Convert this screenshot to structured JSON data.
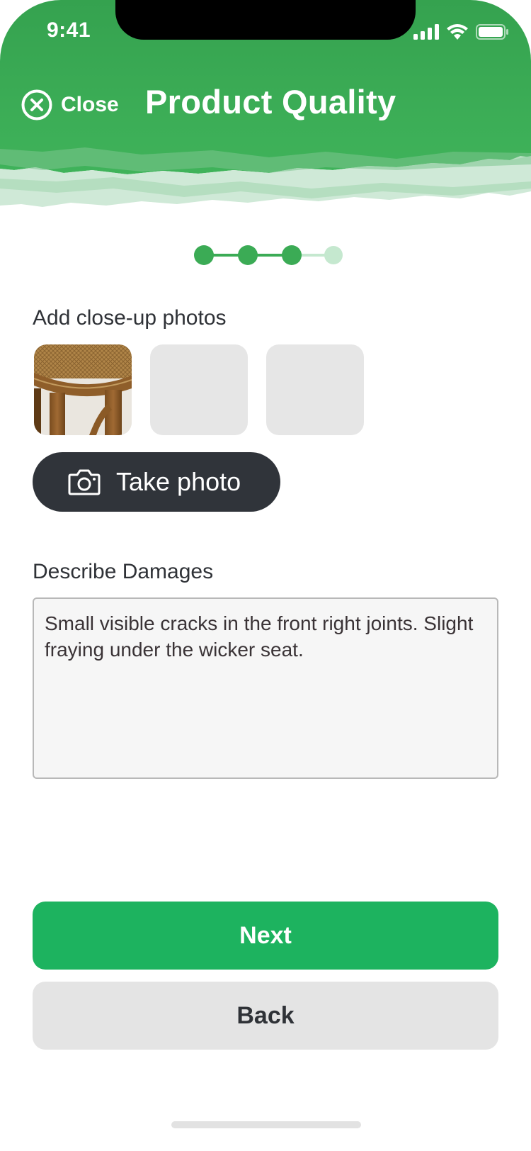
{
  "status_bar": {
    "time": "9:41"
  },
  "header": {
    "close_label": "Close",
    "title": "Product Quality"
  },
  "stepper": {
    "total_steps": 4,
    "completed_steps": 3
  },
  "photos": {
    "label": "Add close-up photos",
    "slots": [
      "chair-closeup-photo",
      "empty",
      "empty"
    ],
    "take_photo_label": "Take photo"
  },
  "damages": {
    "label": "Describe Damages",
    "value": "Small visible cracks in the front right joints. Slight fraying under the wicker seat."
  },
  "actions": {
    "next_label": "Next",
    "back_label": "Back"
  },
  "colors": {
    "brand_green": "#3bab55",
    "button_green": "#1db35f",
    "dark_button": "#30343a",
    "step_inactive": "#c5e8cf"
  },
  "icons": [
    "close-circle-icon",
    "signal-icon",
    "wifi-icon",
    "battery-icon",
    "camera-icon"
  ]
}
